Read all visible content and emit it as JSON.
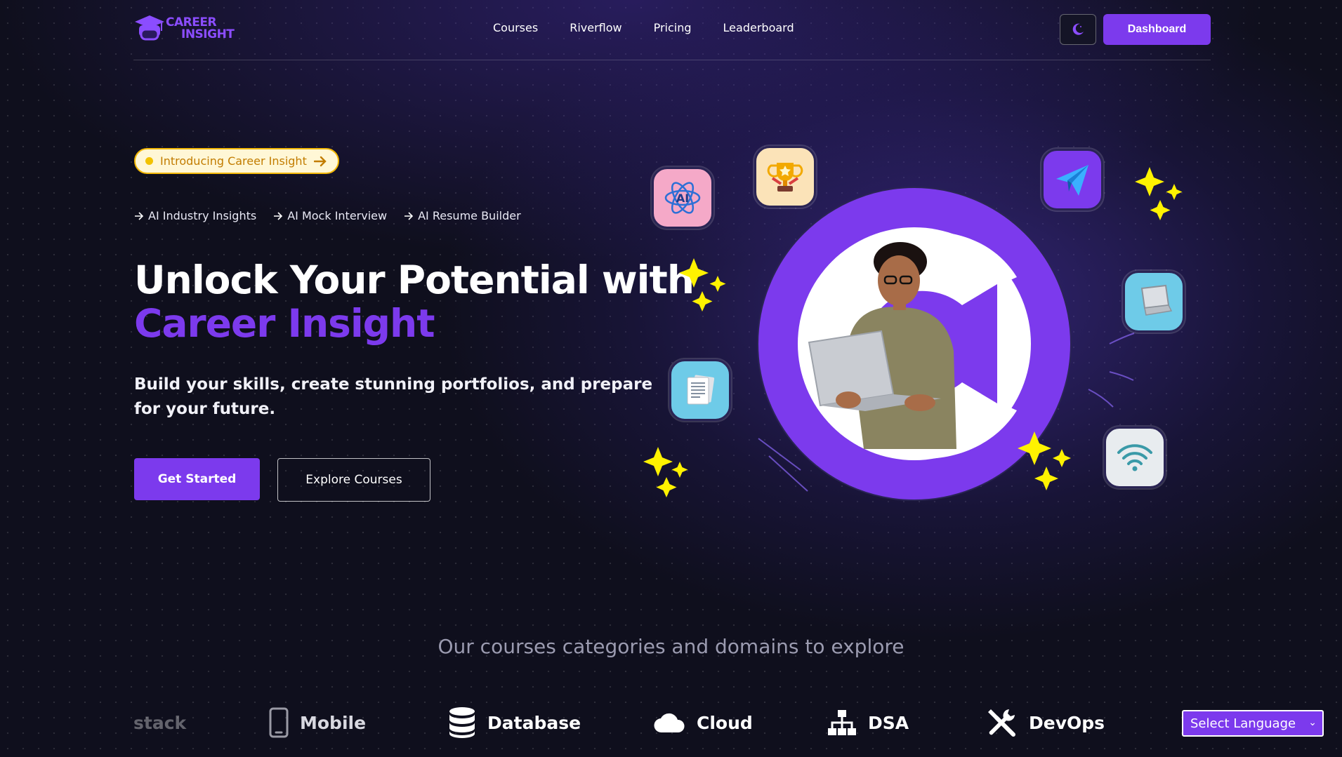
{
  "header": {
    "logo": {
      "line1": "CAREER",
      "line2": "INSIGHT"
    },
    "nav": [
      "Courses",
      "Riverflow",
      "Pricing",
      "Leaderboard"
    ],
    "theme_icon": "moon-icon",
    "dashboard_label": "Dashboard"
  },
  "hero": {
    "badge": "Introducing Career Insight",
    "features": [
      "AI Industry Insights",
      "AI Mock Interview",
      "AI Resume Builder"
    ],
    "title_line1": "Unlock Your Potential with",
    "title_line2": "Career Insight",
    "subtitle": "Build your skills, create stunning portfolios, and prepare for your future.",
    "primary_cta": "Get Started",
    "secondary_cta": "Explore Courses"
  },
  "illustration": {
    "ai_label": "AI",
    "icons": [
      "ai-atom-icon",
      "trophy-icon",
      "paper-plane-icon",
      "laptop-icon",
      "documents-icon",
      "wifi-icon",
      "sparkle-icon"
    ]
  },
  "categories": {
    "title": "Our courses categories and domains to explore",
    "items": [
      {
        "label": "stack",
        "icon": "stack-icon"
      },
      {
        "label": "Mobile",
        "icon": "mobile-icon"
      },
      {
        "label": "Database",
        "icon": "database-icon"
      },
      {
        "label": "Cloud",
        "icon": "cloud-icon"
      },
      {
        "label": "DSA",
        "icon": "sitemap-icon"
      },
      {
        "label": "DevOps",
        "icon": "tools-icon"
      }
    ]
  },
  "language_select": {
    "label": "Select Language"
  },
  "colors": {
    "accent": "#7c3aed",
    "sparkle": "#fff200",
    "background": "#0f0f1d"
  }
}
